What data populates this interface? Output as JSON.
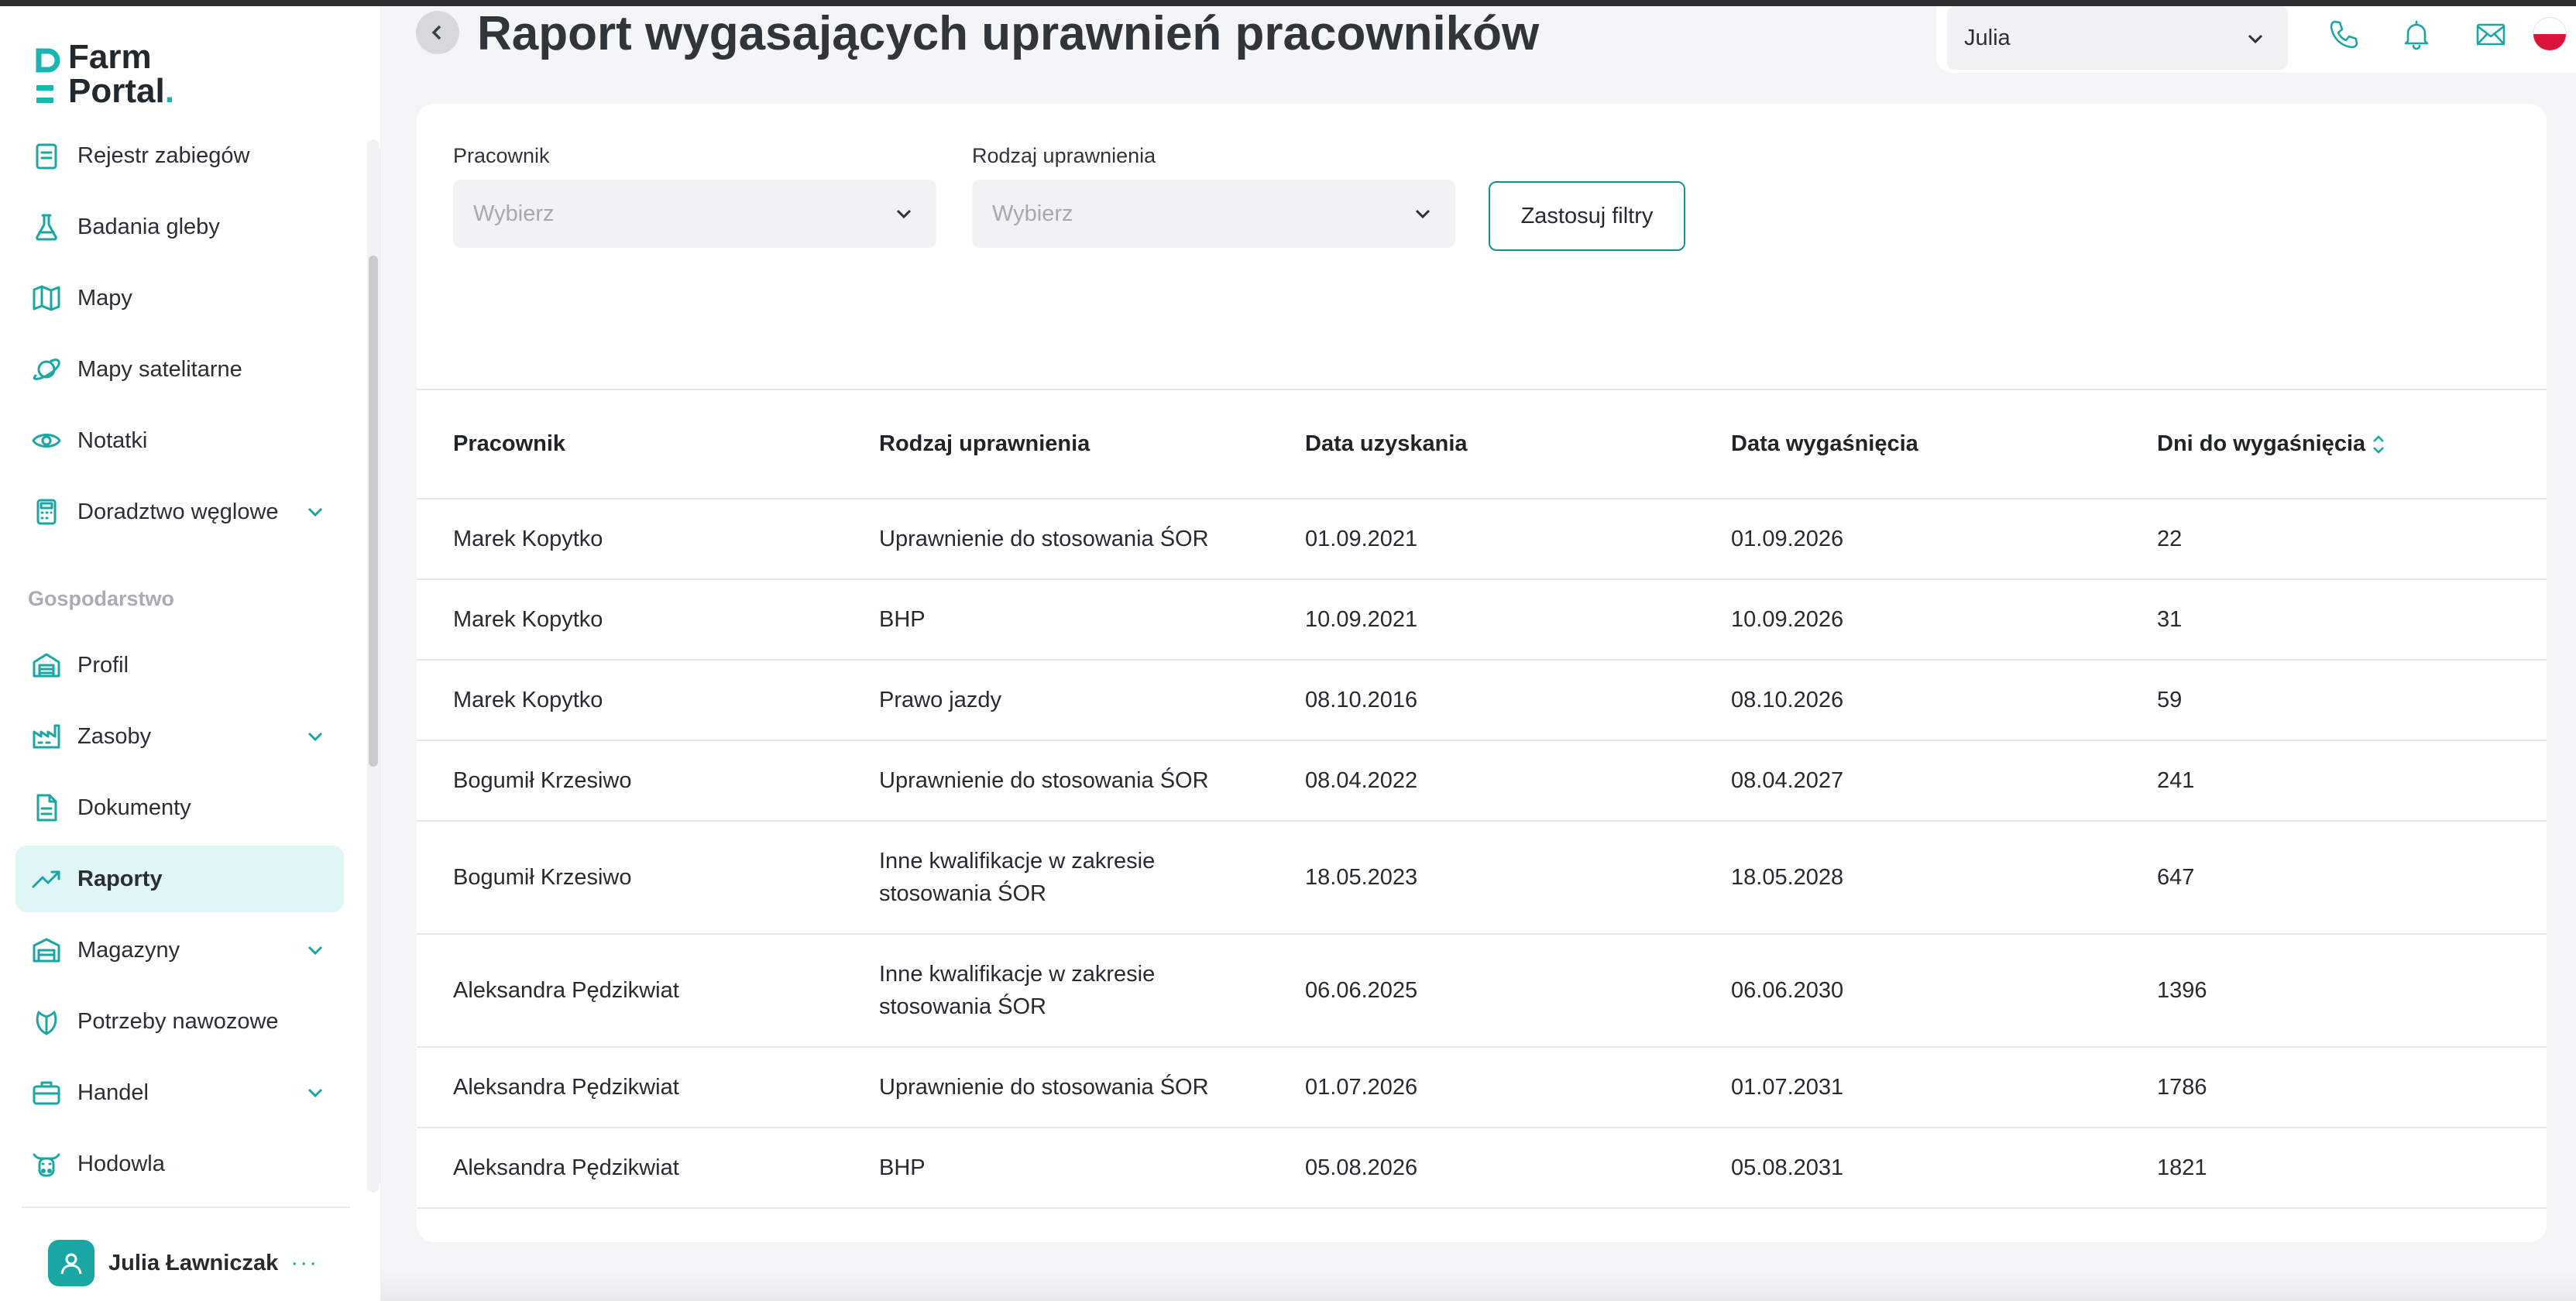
{
  "app": {
    "logo_line1": "Farm",
    "logo_line2": "Portal",
    "logo_dot": ".",
    "accent_color": "#1aa7a4"
  },
  "sidebar": {
    "items": [
      {
        "label": "Rejestr zabiegów",
        "icon": "clipboard-list-icon"
      },
      {
        "label": "Badania gleby",
        "icon": "flask-icon"
      },
      {
        "label": "Mapy",
        "icon": "map-icon"
      },
      {
        "label": "Mapy satelitarne",
        "icon": "planet-icon"
      },
      {
        "label": "Notatki",
        "icon": "eye-icon"
      },
      {
        "label": "Doradztwo węglowe",
        "icon": "calculator-icon",
        "expandable": true
      }
    ],
    "section_label": "Gospodarstwo",
    "section_items": [
      {
        "label": "Profil",
        "icon": "warehouse-icon"
      },
      {
        "label": "Zasoby",
        "icon": "factory-icon",
        "expandable": true
      },
      {
        "label": "Dokumenty",
        "icon": "document-icon"
      },
      {
        "label": "Raporty",
        "icon": "trending-up-icon",
        "active": true
      },
      {
        "label": "Magazyny",
        "icon": "storage-icon",
        "expandable": true
      },
      {
        "label": "Potrzeby nawozowe",
        "icon": "leaf-icon"
      },
      {
        "label": "Handel",
        "icon": "briefcase-icon",
        "expandable": true
      },
      {
        "label": "Hodowla",
        "icon": "cow-icon"
      }
    ],
    "user": {
      "name": "Julia Ławniczak",
      "more": "···"
    }
  },
  "header": {
    "title": "Raport wygasających uprawnień pracowników",
    "user_select_value": "Julia",
    "icons": [
      "phone-icon",
      "bell-icon",
      "mail-icon",
      "flag-pl-icon"
    ]
  },
  "filters": {
    "employee_label": "Pracownik",
    "employee_placeholder": "Wybierz",
    "permission_label": "Rodzaj uprawnienia",
    "permission_placeholder": "Wybierz",
    "apply_label": "Zastosuj filtry"
  },
  "table": {
    "headers": [
      "Pracownik",
      "Rodzaj uprawnienia",
      "Data uzyskania",
      "Data wygaśnięcia",
      "Dni do wygaśnięcia"
    ],
    "rows": [
      [
        "Marek Kopytko",
        "Uprawnienie do stosowania ŚOR",
        "01.09.2021",
        "01.09.2026",
        "22"
      ],
      [
        "Marek Kopytko",
        "BHP",
        "10.09.2021",
        "10.09.2026",
        "31"
      ],
      [
        "Marek Kopytko",
        "Prawo jazdy",
        "08.10.2016",
        "08.10.2026",
        "59"
      ],
      [
        "Bogumił Krzesiwo",
        "Uprawnienie do stosowania ŚOR",
        "08.04.2022",
        "08.04.2027",
        "241"
      ],
      [
        "Bogumił Krzesiwo",
        "Inne kwalifikacje w zakresie stosowania ŚOR",
        "18.05.2023",
        "18.05.2028",
        "647"
      ],
      [
        "Aleksandra Pędzikwiat",
        "Inne kwalifikacje w zakresie stosowania ŚOR",
        "06.06.2025",
        "06.06.2030",
        "1396"
      ],
      [
        "Aleksandra Pędzikwiat",
        "Uprawnienie do stosowania ŚOR",
        "01.07.2026",
        "01.07.2031",
        "1786"
      ],
      [
        "Aleksandra Pędzikwiat",
        "BHP",
        "05.08.2026",
        "05.08.2031",
        "1821"
      ]
    ]
  }
}
